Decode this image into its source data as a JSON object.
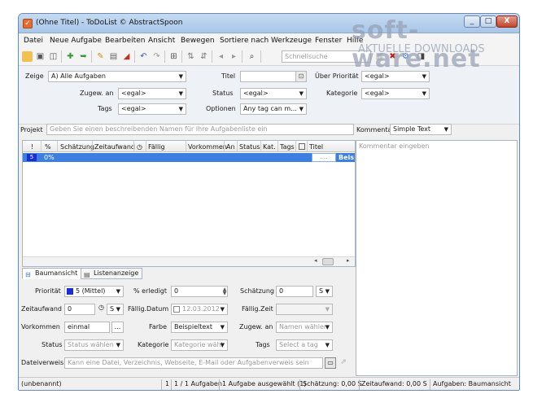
{
  "window": {
    "title": "(Ohne Titel) - ToDoList © AbstractSpoon",
    "minimize": "_",
    "maximize": "□",
    "close": "X"
  },
  "menu": [
    "Datei",
    "Neue Aufgabe",
    "Bearbeiten",
    "Ansicht",
    "Bewegen",
    "Sortiere nach",
    "Werkzeuge",
    "Fenster",
    "Hilfe"
  ],
  "toolbar": {
    "quicksearch_placeholder": "Schnellsuche"
  },
  "filters": {
    "show_label": "Zeige",
    "show_value": "A)  Alle Aufgaben",
    "assigned_label": "Zugew. an",
    "assigned_value": "<egal>",
    "tags_label": "Tags",
    "tags_value": "<egal>",
    "title_label": "Titel",
    "title_value": "",
    "status_label": "Status",
    "status_value": "<egal>",
    "options_label": "Optionen",
    "options_value": "Any tag can m...",
    "priority_label": "Über Priorität",
    "priority_value": "<egal>",
    "category_label": "Kategorie",
    "category_value": "<egal>"
  },
  "project": {
    "label": "Projekt",
    "placeholder": "Geben Sie einen beschreibenden Namen für Ihre Aufgabenliste ein"
  },
  "comments": {
    "label": "Kommentar",
    "format_value": "Simple Text",
    "placeholder": "Kommentar eingeben"
  },
  "tasklist": {
    "columns": [
      "!",
      "%",
      "Schätzung",
      "Zeitaufwand",
      "◷",
      "Fällig",
      "Vorkommen",
      "An",
      "Status",
      "Kat.",
      "Tags",
      "",
      "Titel"
    ],
    "row": {
      "priority": "5",
      "percent": "0%",
      "title": "Beis",
      "ellipsis": "...."
    }
  },
  "tabs": {
    "tree": "Baumansicht",
    "list": "Listenanzeige"
  },
  "details": {
    "priority_label": "Priorität",
    "priority_value": "5 (Mittel)",
    "done_label": "% erledigt",
    "done_value": "0",
    "estimate_label": "Schätzung",
    "estimate_value": "0",
    "estimate_unit": "S",
    "timespent_label": "Zeitaufwand",
    "timespent_value": "0",
    "timespent_unit": "S",
    "duedate_label": "Fällig.Datum",
    "duedate_value": "12.03.2012",
    "duetime_label": "Fällig.Zeit",
    "duetime_value": "",
    "recurrence_label": "Vorkommen",
    "recurrence_value": "einmal",
    "recurrence_btn": "...",
    "color_label": "Farbe",
    "color_value": "Beispieltext",
    "assigned_label": "Zugew. an",
    "assigned_placeholder": "Namen wählen",
    "status_label": "Status",
    "status_placeholder": "Status wählen",
    "category_label": "Kategorie",
    "category_placeholder": "Kategorie wähl",
    "tags_label": "Tags",
    "tags_placeholder": "Select a tag",
    "fileref_label": "Dateiverweis",
    "fileref_placeholder": "Kann eine Datei, Verzeichnis, Webseite, E-Mail oder Aufgabenverweis sein"
  },
  "status": {
    "file": "(unbenannt)",
    "count": "1",
    "tasks": "1 / 1 Aufgaben",
    "selected": "1 Aufgabe ausgewählt (1)",
    "estimate": "Schätzung: 0,00 S",
    "spent": "Zeitaufwand: 0,00 S",
    "view": "Aufgaben: Baumansicht"
  },
  "watermark": {
    "text": "soft-ware.net",
    "sub": "AKTUELLE DOWNLOADS"
  },
  "colors": {
    "selection": "#3c7fe0",
    "accent": "#e86a2c",
    "priority_swatch": "#1b2fd0"
  }
}
